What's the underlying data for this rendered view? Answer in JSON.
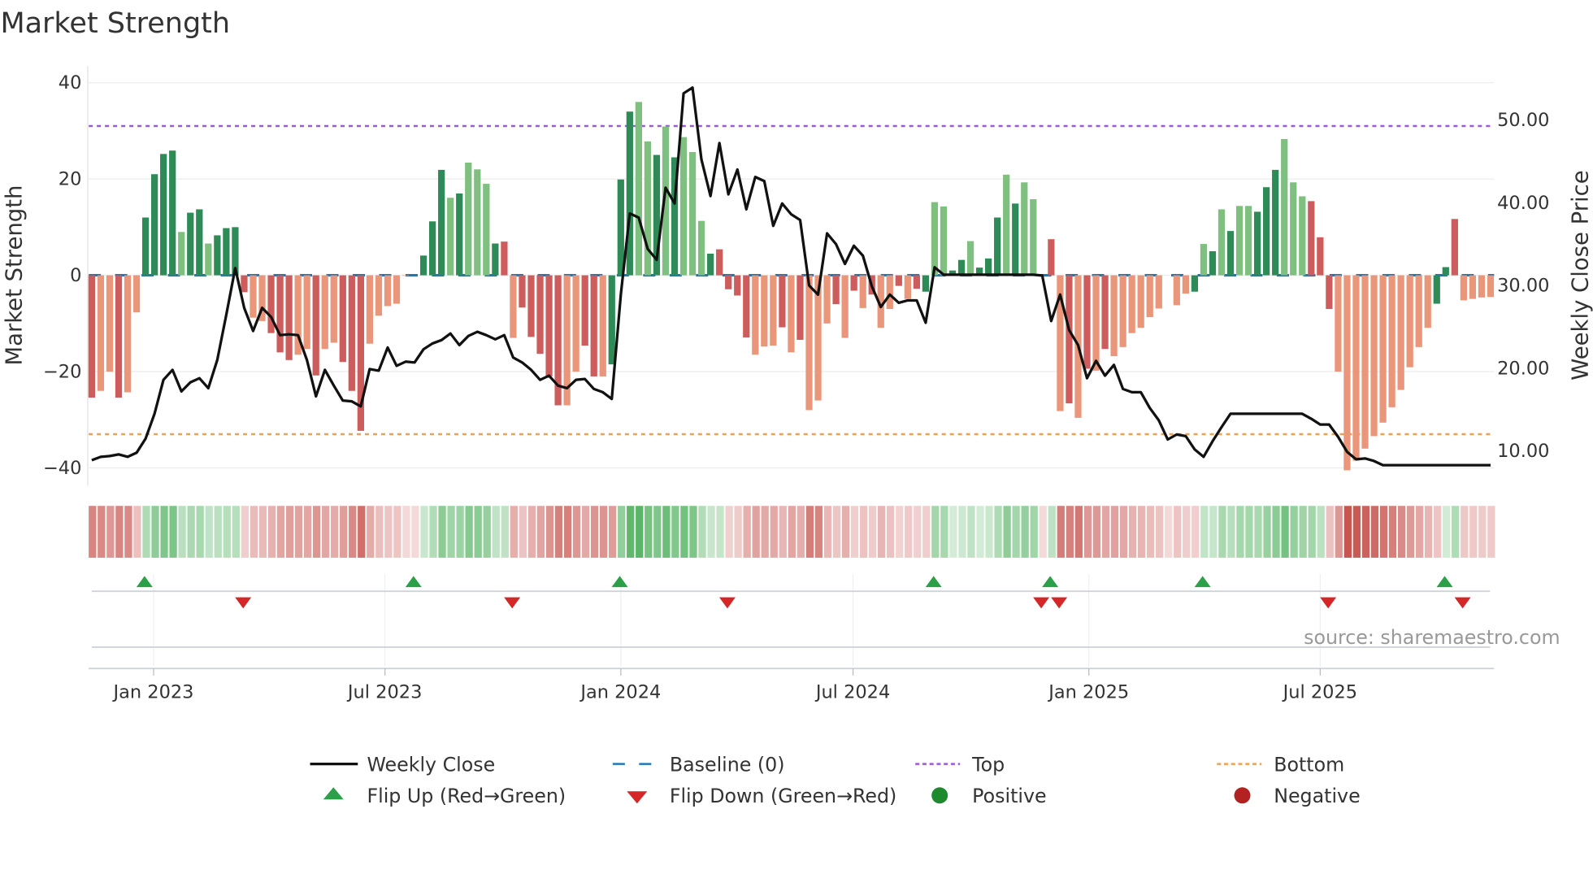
{
  "title": "Market Strength",
  "source": "source: sharemaestro.com",
  "colors": {
    "strong_pos": "#2e8b57",
    "weak_pos": "#7fbf7f",
    "strong_neg": "#cd5c5c",
    "weak_neg": "#e9967a",
    "top": "#9b59d6",
    "bottom": "#f0a050",
    "baseline": "#1f77b4",
    "line": "#111111",
    "flip_up": "#2ca048",
    "flip_down": "#d62728"
  },
  "chart_data": {
    "type": "bar+line",
    "title": "Market Strength",
    "ylabel": "Market Strength",
    "y2label": "Weekly Close Price",
    "ylim": [
      -44,
      44
    ],
    "y2lim": [
      8,
      56
    ],
    "y_ticks": [
      {
        "v": 40,
        "label": "40"
      },
      {
        "v": 20,
        "label": "20"
      },
      {
        "v": 0,
        "label": "0"
      },
      {
        "v": -20,
        "label": "−20"
      },
      {
        "v": -40,
        "label": "−40"
      }
    ],
    "y2_ticks": [
      {
        "v": 50,
        "label": "50.00"
      },
      {
        "v": 40,
        "label": "40.00"
      },
      {
        "v": 30,
        "label": "30.00"
      },
      {
        "v": 20,
        "label": "20.00"
      },
      {
        "v": 10,
        "label": "10.00"
      }
    ],
    "x_ticks": [
      {
        "week": 6.9,
        "label": "Jan 2023"
      },
      {
        "week": 32.7,
        "label": "Jul 2023"
      },
      {
        "week": 59,
        "label": "Jan 2024"
      },
      {
        "week": 84.9,
        "label": "Jul 2024"
      },
      {
        "week": 111.2,
        "label": "Jan 2025"
      },
      {
        "week": 137,
        "label": "Jul 2025"
      }
    ],
    "top": 31,
    "bottom": -33,
    "strength": [
      -25.4,
      -24,
      -20,
      -25.4,
      -24.3,
      -7.7,
      12,
      21,
      25.2,
      25.9,
      9,
      13,
      13.7,
      6.6,
      8.3,
      9.8,
      10,
      -3.5,
      -8.8,
      -9.5,
      -12,
      -16,
      -17.6,
      -16.5,
      -15.3,
      -20.8,
      -15.3,
      -14,
      -18,
      -24,
      -32.3,
      -14.2,
      -8.4,
      -6.4,
      -5.9,
      -0.1,
      0,
      4.1,
      11.2,
      21.9,
      16.1,
      17,
      23.4,
      22,
      19,
      6.6,
      7,
      -13,
      -6.7,
      -12.8,
      -16.3,
      -21,
      -27,
      -27,
      -20,
      -14.6,
      -21,
      -21,
      -18.5,
      19.9,
      34,
      36,
      27.8,
      25,
      30.9,
      24.5,
      28.7,
      25.6,
      11.3,
      4.5,
      5.4,
      -2.9,
      -4.2,
      -12.9,
      -16.5,
      -14.8,
      -14.6,
      -10.8,
      -16,
      -13.4,
      -28,
      -26,
      -10,
      -6,
      -13,
      -3.2,
      -6.8,
      -4,
      -10.9,
      -7,
      -2.2,
      -4.9,
      -2.8,
      -3.4,
      15.2,
      14.3,
      1,
      3.2,
      7.1,
      1.6,
      3.5,
      12,
      20.9,
      14.9,
      19.3,
      15.8,
      0,
      7.5,
      -28.2,
      -26.6,
      -29.6,
      -19.4,
      -19.8,
      -15.3,
      -16.8,
      -14.9,
      -12,
      -10.9,
      -8.7,
      -6.9,
      0,
      -6.2,
      -3.8,
      -3.4,
      6.5,
      5,
      13.7,
      9.2,
      14.4,
      14.4,
      13.2,
      18.3,
      21.9,
      28.3,
      19.3,
      16.4,
      15.4,
      7.9,
      -7,
      -20,
      -40.5,
      -38.5,
      -36,
      -33.4,
      -30.6,
      -27.4,
      -23.8,
      -19.1,
      -14.9,
      -10.9,
      -5.9,
      1.7,
      11.7,
      -5.2,
      -4.9,
      -4.6,
      -4.5
    ],
    "tone": "RrrRrrGGGGgGGgGGGRrrRRRrrRrrRRRrrrrrrGGGgGgggGRrRRRRRrrRRrGGGggGgGgggGRRRRrrrRrRrrrRrRrRrrRrRGggGGgGGGgGg?GRrRrRrRrrrrr?RrrGgGgGggGGGgggRRRrrrrrrrrrrrGGRrrr",
    "weekly_close": [
      8.9,
      9.3,
      9.4,
      9.6,
      9.3,
      9.8,
      11.5,
      14.5,
      18.6,
      19.8,
      17.2,
      18.3,
      18.8,
      17.6,
      21,
      26.4,
      32.1,
      27.3,
      24.5,
      27.3,
      26.2,
      24,
      24.1,
      24,
      21,
      16.6,
      19.8,
      17.9,
      16.1,
      16,
      15.4,
      19.9,
      19.7,
      22.5,
      20.3,
      20.8,
      20.7,
      22.3,
      23,
      23.4,
      24.2,
      22.8,
      23.9,
      24.4,
      24,
      23.5,
      24,
      21.3,
      20.7,
      19.8,
      18.6,
      19.1,
      17.9,
      17.6,
      18.6,
      18.7,
      17.5,
      17.1,
      16.3,
      28.9,
      38.7,
      38.2,
      34.4,
      33.1,
      41.8,
      39.9,
      53.2,
      53.9,
      45.2,
      40.8,
      47.2,
      41,
      44,
      39.2,
      43.1,
      42.6,
      37.2,
      39.9,
      38.6,
      37.9,
      30,
      28.9,
      36.3,
      35,
      32.6,
      34.8,
      33.6,
      29.9,
      27.4,
      28.9,
      27.9,
      28.2,
      28.2,
      25.5,
      32.2,
      31.3,
      31.3,
      31.3,
      31.3,
      31.3,
      31.3,
      31.3,
      31.3,
      31.3,
      31.3,
      31.3,
      31.2,
      25.7,
      28.9,
      24.6,
      22.8,
      18.8,
      20.9,
      19.1,
      20.4,
      17.5,
      17.1,
      17.1,
      15.2,
      13.7,
      11.4,
      12,
      11.8,
      10.2,
      9.3,
      11.2,
      12.9,
      14.5,
      14.5,
      14.5,
      14.5,
      14.5,
      14.5,
      14.5,
      14.5,
      14.5,
      13.9,
      13.2,
      13.2,
      11.7,
      9.9,
      9,
      9.1,
      8.8,
      8.3,
      8.3,
      8.3,
      8.3,
      8.3,
      8.3,
      8.3,
      8.3,
      8.3,
      8.3,
      8.3,
      8.3,
      8.3
    ],
    "flip_up_weeks": [
      6,
      36,
      59,
      94,
      107,
      124,
      151
    ],
    "flip_down_weeks": [
      17,
      47,
      71,
      106,
      108,
      138,
      153
    ],
    "legend": [
      {
        "key": "line",
        "label": "Weekly Close"
      },
      {
        "key": "baseline",
        "label": "Baseline (0)"
      },
      {
        "key": "top",
        "label": "Top"
      },
      {
        "key": "bottom",
        "label": "Bottom"
      },
      {
        "key": "up",
        "label": "Flip Up (Red→Green)"
      },
      {
        "key": "down",
        "label": "Flip Down (Green→Red)"
      },
      {
        "key": "pos",
        "label": "Positive"
      },
      {
        "key": "neg",
        "label": "Negative"
      }
    ]
  }
}
